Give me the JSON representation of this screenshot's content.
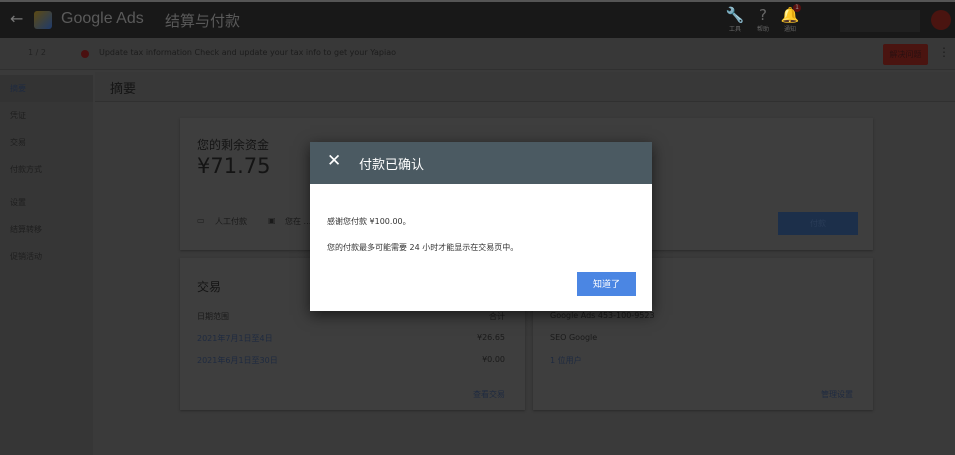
{
  "header": {
    "brand": "Google Ads",
    "title": "结算与付款",
    "icons": [
      {
        "name": "tools",
        "label": "工具"
      },
      {
        "name": "help",
        "label": "帮助"
      },
      {
        "name": "notifications",
        "label": "通知",
        "badge": "1"
      }
    ]
  },
  "notification": {
    "pager": "1 / 2",
    "message": "Update tax information  Check and update your tax info to get your Yapiao",
    "action": "解决问题"
  },
  "sidebar": {
    "items": [
      "摘要",
      "凭证",
      "交易",
      "付款方式",
      "设置",
      "结算转移",
      "促销活动"
    ]
  },
  "page_title": "摘要",
  "funds": {
    "label": "您的剩余资金",
    "amount": "¥71.75",
    "options": [
      "人工付款",
      "您在 ..."
    ],
    "pay_button": "付款"
  },
  "transactions": {
    "title": "交易",
    "header": [
      "日期范围",
      "合计"
    ],
    "rows": [
      [
        "2021年7月1日至4日",
        "¥26.65"
      ],
      [
        "2021年6月1日至30日",
        "¥0.00"
      ]
    ],
    "link": "查看交易"
  },
  "settings": {
    "rows": [
      "Google Ads 453-100-9523",
      "SEO Google",
      "1 位用户"
    ],
    "link": "管理设置"
  },
  "dialog": {
    "title": "付款已确认",
    "line1": "感谢您付款 ¥100.00。",
    "line2": "您的付款最多可能需要 24 小时才能显示在交易页中。",
    "ok": "知道了"
  }
}
